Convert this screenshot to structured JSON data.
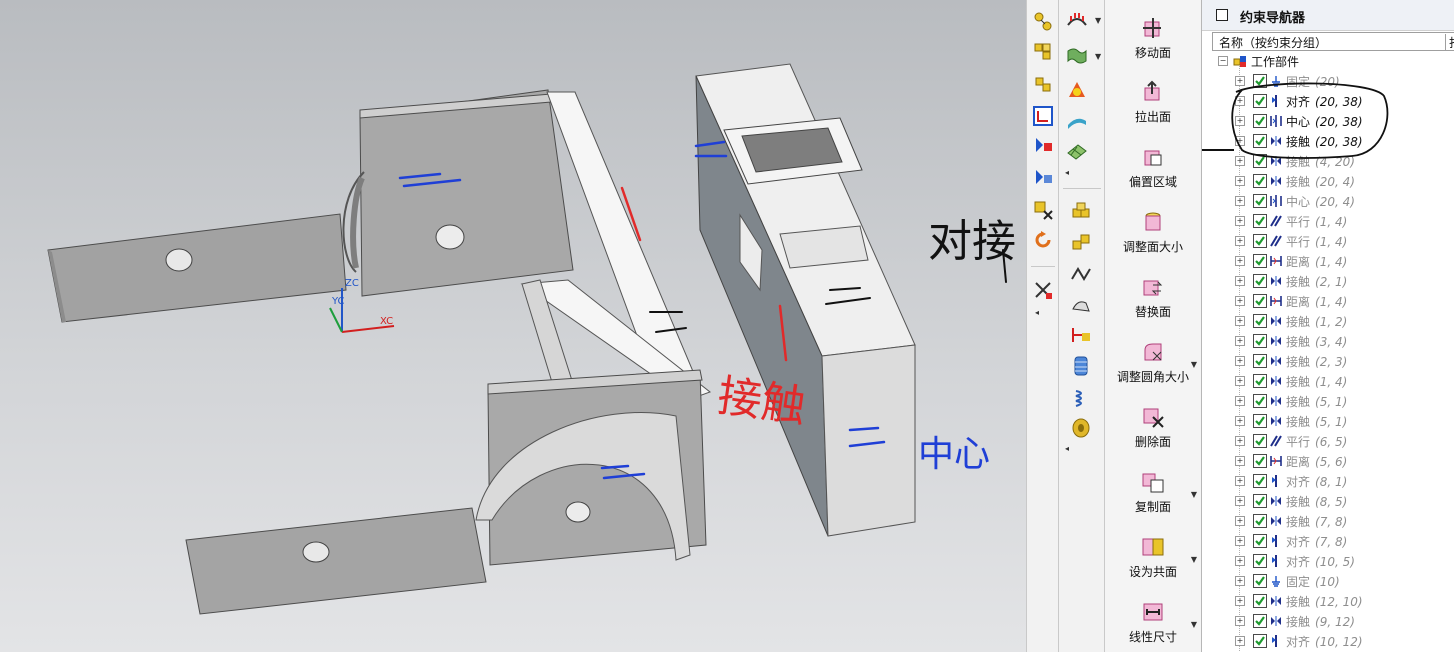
{
  "viewport": {
    "annotations": {
      "to_change": "对接",
      "contact": "接触",
      "center": "中心"
    },
    "axes": {
      "zc": "ZC",
      "yc": "YC",
      "xc": "XC"
    }
  },
  "toolbar": {
    "col1_icons": [
      "assembly-constraint-icon",
      "assembly-move-icon",
      "assembly-group-icon",
      "coordinate-icon",
      "measure-icon",
      "measure2-icon",
      "delete-cut-icon",
      "rotate-icon",
      "close-x-icon"
    ],
    "col2_icons": [
      "surface-comb-icon",
      "sheet-wave-icon",
      "face-color-icon",
      "face-flat-icon",
      "face-grid-icon",
      "cube-stack-icon",
      "cube-stack2-icon",
      "draft-icon",
      "draft2-icon",
      "pen-icon",
      "spring-icon",
      "coil-icon",
      "disc-icon"
    ],
    "big_buttons": [
      {
        "label": "移动面",
        "dropdown": false
      },
      {
        "label": "拉出面",
        "dropdown": false
      },
      {
        "label": "偏置区域",
        "dropdown": false
      },
      {
        "label": "调整面大小",
        "dropdown": false
      },
      {
        "label": "替换面",
        "dropdown": false
      },
      {
        "label": "调整圆角大小",
        "dropdown": true
      },
      {
        "label": "删除面",
        "dropdown": false
      },
      {
        "label": "复制面",
        "dropdown": true
      },
      {
        "label": "设为共面",
        "dropdown": true
      },
      {
        "label": "线性尺寸",
        "dropdown": true
      }
    ]
  },
  "navigator": {
    "title": "约束导航器",
    "col_name": "名称（按约束分组）",
    "col_extra": "打",
    "root": "工作部件",
    "rows": [
      {
        "name": "固定",
        "params": "(20)",
        "icon": "fix",
        "active": false
      },
      {
        "name": "对齐",
        "params": "(20, 38)",
        "icon": "align",
        "active": true
      },
      {
        "name": "中心",
        "params": "(20, 38)",
        "icon": "center",
        "active": true
      },
      {
        "name": "接触",
        "params": "(20, 38)",
        "icon": "touch",
        "active": true
      },
      {
        "name": "接触",
        "params": "(4, 20)",
        "icon": "touch",
        "active": false
      },
      {
        "name": "接触",
        "params": "(20, 4)",
        "icon": "touch",
        "active": false
      },
      {
        "name": "中心",
        "params": "(20, 4)",
        "icon": "center",
        "active": false
      },
      {
        "name": "平行",
        "params": "(1, 4)",
        "icon": "parallel",
        "active": false
      },
      {
        "name": "平行",
        "params": "(1, 4)",
        "icon": "parallel",
        "active": false
      },
      {
        "name": "距离",
        "params": "(1, 4)",
        "icon": "distance",
        "active": false
      },
      {
        "name": "接触",
        "params": "(2, 1)",
        "icon": "touch",
        "active": false
      },
      {
        "name": "距离",
        "params": "(1, 4)",
        "icon": "distance",
        "active": false
      },
      {
        "name": "接触",
        "params": "(1, 2)",
        "icon": "touch",
        "active": false
      },
      {
        "name": "接触",
        "params": "(3, 4)",
        "icon": "touch",
        "active": false
      },
      {
        "name": "接触",
        "params": "(2, 3)",
        "icon": "touch",
        "active": false
      },
      {
        "name": "接触",
        "params": "(1, 4)",
        "icon": "touch",
        "active": false
      },
      {
        "name": "接触",
        "params": "(5, 1)",
        "icon": "touch",
        "active": false
      },
      {
        "name": "接触",
        "params": "(5, 1)",
        "icon": "touch",
        "active": false
      },
      {
        "name": "平行",
        "params": "(6, 5)",
        "icon": "parallel",
        "active": false
      },
      {
        "name": "距离",
        "params": "(5, 6)",
        "icon": "distance",
        "active": false
      },
      {
        "name": "对齐",
        "params": "(8, 1)",
        "icon": "align",
        "active": false
      },
      {
        "name": "接触",
        "params": "(8, 5)",
        "icon": "touch",
        "active": false
      },
      {
        "name": "接触",
        "params": "(7, 8)",
        "icon": "touch",
        "active": false
      },
      {
        "name": "对齐",
        "params": "(7, 8)",
        "icon": "align",
        "active": false
      },
      {
        "name": "对齐",
        "params": "(10, 5)",
        "icon": "align",
        "active": false
      },
      {
        "name": "固定",
        "params": "(10)",
        "icon": "fix",
        "active": false
      },
      {
        "name": "接触",
        "params": "(12, 10)",
        "icon": "touch",
        "active": false
      },
      {
        "name": "接触",
        "params": "(9, 12)",
        "icon": "touch",
        "active": false
      },
      {
        "name": "对齐",
        "params": "(10, 12)",
        "icon": "align",
        "active": false
      }
    ]
  }
}
